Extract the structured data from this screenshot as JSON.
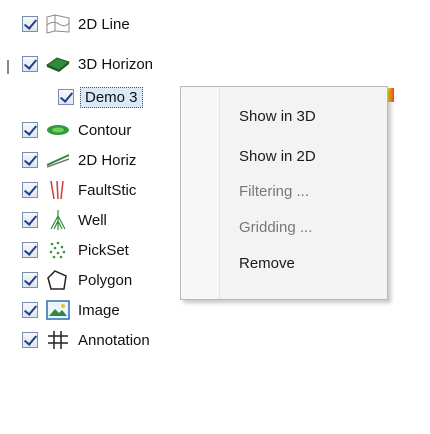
{
  "tree": {
    "items": [
      {
        "label": "2D Line",
        "icon": "2d-line-icon"
      },
      {
        "label": "3D Horizon",
        "icon": "3d-horizon-icon"
      },
      {
        "label": "Demo 3",
        "icon": ""
      },
      {
        "label": "Contour",
        "icon": "contour-icon"
      },
      {
        "label": "2D Horiz",
        "icon": "2d-horizon-icon"
      },
      {
        "label": "FaultStic",
        "icon": "faultstick-icon"
      },
      {
        "label": "Well",
        "icon": "well-icon"
      },
      {
        "label": "PickSet",
        "icon": "pickset-icon"
      },
      {
        "label": "Polygon",
        "icon": "polygon-icon"
      },
      {
        "label": "Image",
        "icon": "image-icon"
      },
      {
        "label": "Annotation",
        "icon": "annotation-icon"
      }
    ]
  },
  "context_menu": {
    "items": [
      {
        "label": "Show in 3D"
      },
      {
        "label": "Show in 2D"
      },
      {
        "label": "Filtering ..."
      },
      {
        "label": "Gridding ..."
      },
      {
        "label": "Remove"
      }
    ]
  },
  "colors": {
    "selection_bg": "#dbe8f7",
    "checkbox_check": "#1f3f8a"
  }
}
